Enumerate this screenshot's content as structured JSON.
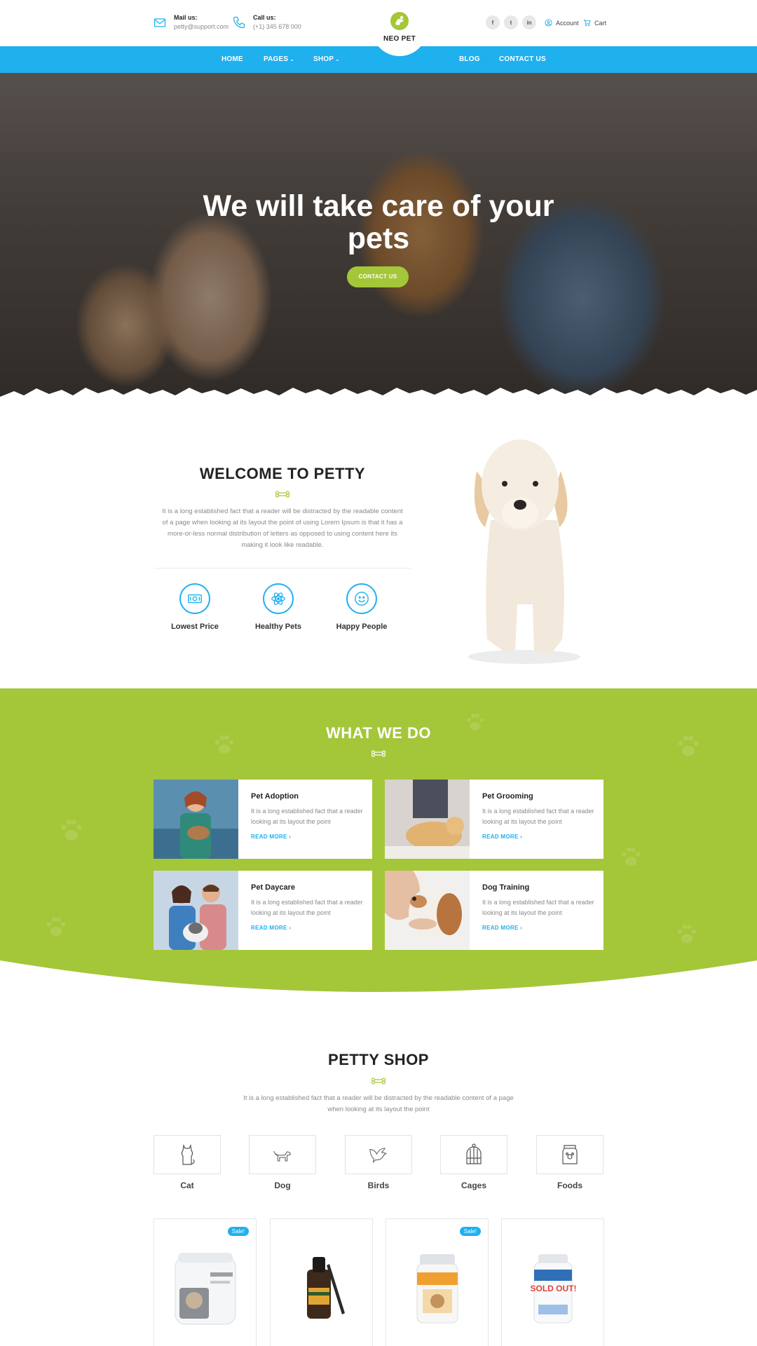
{
  "topbar": {
    "mail_label": "Mail us:",
    "mail_value": "petty@support.com",
    "call_label": "Call us:",
    "call_value": "(+1) 345 678 000",
    "brand": "NEO PET",
    "socials": [
      "f",
      "t",
      "in"
    ],
    "account_label": "Account",
    "cart_label": "Cart"
  },
  "nav": {
    "items": [
      {
        "label": "HOME"
      },
      {
        "label": "PAGES",
        "dropdown": true
      },
      {
        "label": "SHOP",
        "dropdown": true
      },
      {
        "label": "BLOG"
      },
      {
        "label": "CONTACT US"
      }
    ]
  },
  "hero": {
    "title": "We will take care of your pets",
    "button_label": "CONTACT US"
  },
  "welcome": {
    "title": "WELCOME TO PETTY",
    "text": "It is a long established fact that a reader will be distracted by the readable content of a page when looking at its layout the point of using Lorem Ipsum is that it has a more-or-less normal distribution of letters as opposed to using content here its making it look like readable.",
    "features": [
      {
        "name": "Lowest Price",
        "icon": "money-icon"
      },
      {
        "name": "Healthy Pets",
        "icon": "atom-icon"
      },
      {
        "name": "Happy People",
        "icon": "smile-icon"
      }
    ]
  },
  "what_we_do": {
    "title": "WHAT WE DO",
    "cards": [
      {
        "title": "Pet Adoption",
        "text": "It is a long established fact that a reader looking at its layout the point",
        "link": "READ MORE"
      },
      {
        "title": "Pet Grooming",
        "text": "It is a long established fact that a reader looking at its layout the point",
        "link": "READ MORE"
      },
      {
        "title": "Pet Daycare",
        "text": "It is a long established fact that a reader looking at its layout the point",
        "link": "READ MORE"
      },
      {
        "title": "Dog Training",
        "text": "It is a long established fact that a reader looking at its layout the point",
        "link": "READ MORE"
      }
    ]
  },
  "shop": {
    "title": "PETTY SHOP",
    "text": "It is a long established fact that a reader will be distracted by the readable content of a page when looking at its layout the point",
    "categories": [
      {
        "name": "Cat",
        "icon": "cat-icon"
      },
      {
        "name": "Dog",
        "icon": "dog-icon"
      },
      {
        "name": "Birds",
        "icon": "bird-icon"
      },
      {
        "name": "Cages",
        "icon": "cage-icon"
      },
      {
        "name": "Foods",
        "icon": "food-bag-icon"
      }
    ],
    "products": [
      {
        "badge": "Sale!",
        "status": ""
      },
      {
        "badge": "",
        "status": ""
      },
      {
        "badge": "Sale!",
        "status": ""
      },
      {
        "badge": "",
        "status": "SOLD OUT!"
      }
    ]
  },
  "colors": {
    "accent_blue": "#1fb0ee",
    "accent_green": "#a4c639"
  }
}
